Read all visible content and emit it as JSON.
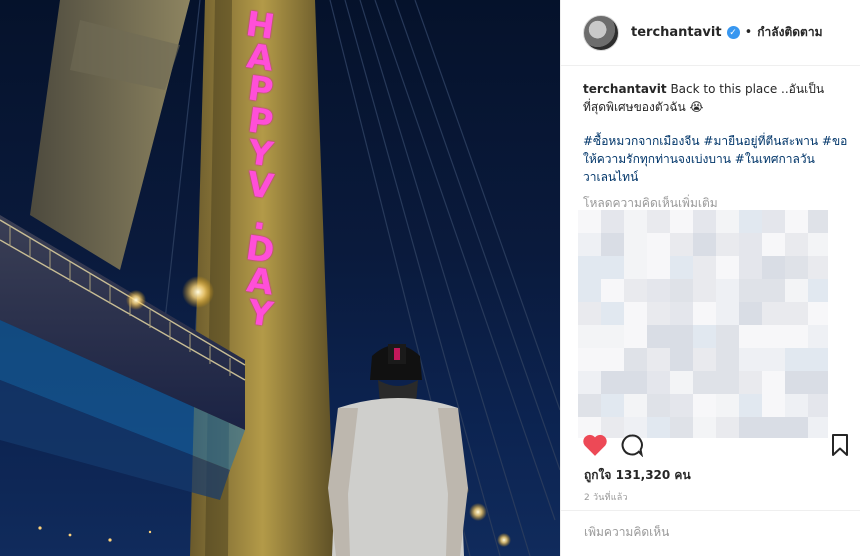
{
  "post": {
    "username": "terchantavit",
    "follow_state": "กำลังติดตาม",
    "caption_user": "terchantavit",
    "caption_text": "Back to this place ..อันเป็นที่สุดพิเศษของตัวฉัน 😭",
    "hashtags": "#ซื้อหมวกจากเมืองจีน #มายืนอยู่ที่ตีนสะพาน #ขอให้ความรักทุกท่านจงเบ่งบาน #ในเทศกาลวันวาเลนไทน์",
    "load_more_comments": "โหลดความคิดเห็นเพิ่มเติม",
    "likes": "ถูกใจ 131,320 คน",
    "time": "2 วันที่แล้ว",
    "comment_placeholder": "เพิ่มความคิดเห็น"
  },
  "photo": {
    "overlay_text": [
      "H",
      "A",
      "P",
      "P",
      "Y",
      "V",
      ".",
      "D",
      "A",
      "Y"
    ],
    "overlay_color": "#ff4fd8"
  },
  "icons": {
    "like": "heart-icon",
    "comment": "comment-icon",
    "save": "bookmark-icon",
    "verified": "verified-badge-icon"
  },
  "colors": {
    "like_red": "#ed4956",
    "hashtag_blue": "#003569",
    "verified_blue": "#3897f0",
    "muted_text": "#999999"
  }
}
